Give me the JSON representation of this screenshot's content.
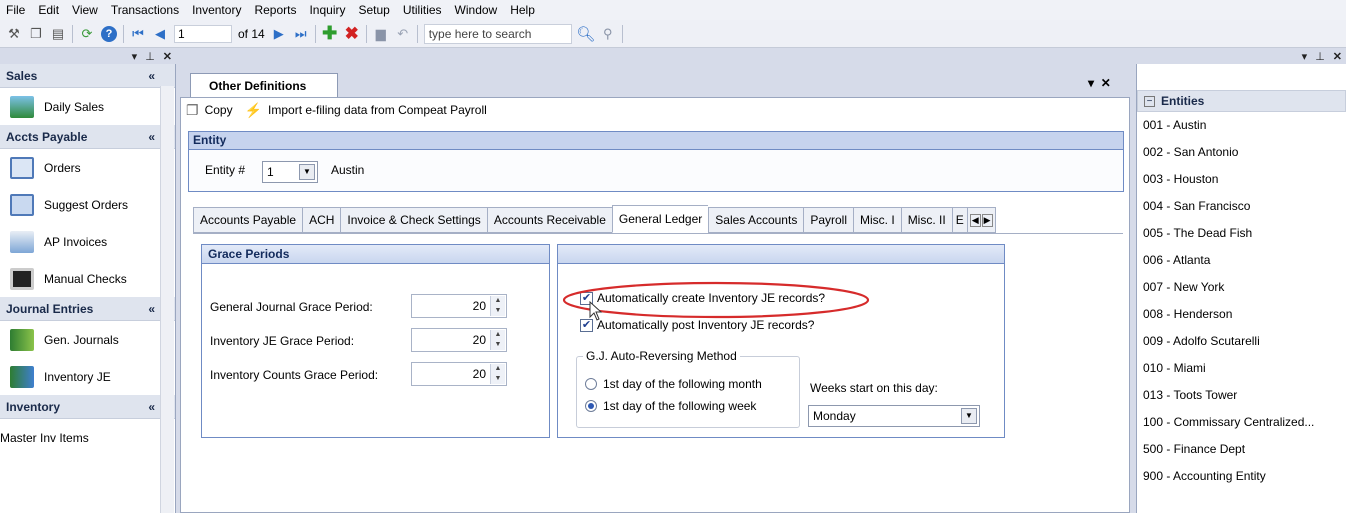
{
  "menu": [
    "File",
    "Edit",
    "View",
    "Transactions",
    "Inventory",
    "Reports",
    "Inquiry",
    "Setup",
    "Utilities",
    "Window",
    "Help"
  ],
  "toolbar": {
    "page_current": "1",
    "page_total": "of 14",
    "search_placeholder": "type here to search"
  },
  "left_panel": {
    "groups": [
      {
        "title": "Sales",
        "items": [
          "Daily Sales"
        ]
      },
      {
        "title": "Accts Payable",
        "items": [
          "Orders",
          "Suggest Orders",
          "AP Invoices",
          "Manual Checks"
        ]
      },
      {
        "title": "Journal Entries",
        "items": [
          "Gen. Journals",
          "Inventory JE"
        ]
      },
      {
        "title": "Inventory",
        "items": [
          "Master Inv Items"
        ]
      }
    ],
    "collapse_glyph": "«"
  },
  "center": {
    "doc_tab": "Other Definitions",
    "copy_label": "Copy",
    "import_label": "Import e-filing data from Compeat Payroll",
    "entity_section": "Entity",
    "entity_label": "Entity #",
    "entity_number": "1",
    "entity_name": "Austin",
    "tabs": [
      "Accounts Payable",
      "ACH",
      "Invoice & Check Settings",
      "Accounts Receivable",
      "General Ledger",
      "Sales Accounts",
      "Payroll",
      "Misc. I",
      "Misc. II",
      "E"
    ],
    "active_tab": "General Ledger",
    "grace": {
      "title": "Grace Periods",
      "rows": [
        {
          "label": "General Journal Grace Period:",
          "value": "20"
        },
        {
          "label": "Inventory JE Grace Period:",
          "value": "20"
        },
        {
          "label": "Inventory Counts Grace Period:",
          "value": "20"
        }
      ]
    },
    "gl_options": {
      "auto_create": "Automatically create Inventory JE records?",
      "auto_post": "Automatically post Inventory JE records?",
      "reversing_title": "G.J. Auto-Reversing Method",
      "radio_month": "1st day of the following month",
      "radio_week": "1st day of the following week",
      "weeks_label": "Weeks start on this day:",
      "weeks_value": "Monday"
    }
  },
  "right_panel": {
    "title": "Entities",
    "items": [
      "001 - Austin",
      "002 - San Antonio",
      "003 - Houston",
      "004 - San Francisco",
      "005 - The Dead Fish",
      "006 - Atlanta",
      "007 - New York",
      "008 - Henderson",
      "009 - Adolfo Scutarelli",
      "010 - Miami",
      "013 - Toots Tower",
      "100 - Commissary Centralized...",
      "500 - Finance Dept",
      "900 - Accounting Entity"
    ]
  },
  "colors": {
    "accent": "#6f8bc4",
    "highlight_ellipse": "#d62b2b"
  }
}
